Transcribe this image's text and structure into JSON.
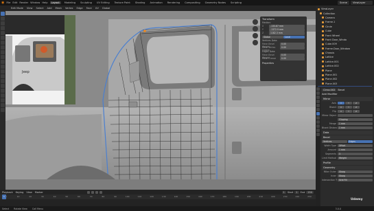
{
  "topbar": {
    "menus": [
      "File",
      "Edit",
      "Render",
      "Window",
      "Help"
    ],
    "tabs": [
      "Layout",
      "Modeling",
      "Sculpting",
      "UV Editing",
      "Texture Paint",
      "Shading",
      "Animation",
      "Rendering",
      "Compositing",
      "Geometry Nodes",
      "Scripting"
    ],
    "active_tab": "Layout",
    "scene": "Scene",
    "view_layer": "ViewLayer"
  },
  "viewport_header": {
    "mode": "Edit Mode",
    "menus": [
      "View",
      "Select",
      "Add",
      "Mesh",
      "Vertex",
      "Edge",
      "Face",
      "UV"
    ],
    "orientation": "Global"
  },
  "npanel": {
    "title": "Transform",
    "median": "Median:",
    "x": "-133.87 mm",
    "y": "-1372.9 mm",
    "z": "1182.3 mm",
    "space_global": "Global",
    "space_local": "Local",
    "vertex_data": "Vertices Data:",
    "mean_bevel_weight_label": "Mean Bevel Weight",
    "mean_bevel_weight": "0.00",
    "mean_vertex_crease_label": "Mean Vertex Crease",
    "mean_vertex_crease": "0.00",
    "edges_data": "Edges Data:",
    "mean_bevel_weight2": "0.00",
    "mean_crease_label": "Mean Crease",
    "mean_crease": "0.00",
    "properties": "Properties"
  },
  "outliner": {
    "items": [
      "ViewLayer",
      "Collection",
      "Camera",
      "Frame.1",
      "Circle",
      "Cube",
      "Front Wheel",
      "Front Door_Windo",
      "Cube.009",
      "Frame.Door_Window",
      "Chassis",
      "Lattice",
      "Lattice.001",
      "Lattice.002",
      "Plane",
      "Plane.001",
      "Plane.002",
      "Plane.003",
      "Plane.004"
    ],
    "selected": "Plane.004"
  },
  "properties": {
    "object": "Cirna.002",
    "modifier_tab": "Bevel",
    "add_modifier": "Add Modifier",
    "mirror_name": "Mirror",
    "axis_label": "Axis",
    "bisect_label": "Bisect",
    "flip_label": "Flip",
    "x": "X",
    "y": "Y",
    "z": "Z",
    "mirror_object_label": "Mirror Object",
    "clipping": "Clipping",
    "merge_label": "Merge",
    "merge_value": "1 mm",
    "bisect_distance_label": "Bisect Distance",
    "bisect_distance": "1 mm",
    "data_section": "Data",
    "bevel_name": "Bevel",
    "vertices": "Vertices",
    "edges": "Edges",
    "width_type_label": "Width Type",
    "width_type": "Offset",
    "amount_label": "Amount",
    "amount": "1 mm",
    "segments_label": "Segments",
    "segments": "3",
    "limit_method_label": "Limit Method",
    "limit_method": "Weight",
    "profile": "Profile",
    "geometry": "Geometry",
    "miter_outer_label": "Miter Outer",
    "miter_outer": "Sharp",
    "inner_label": "Inner",
    "inner": "Sharp",
    "intersection_label": "Intersection Type",
    "intersection": "Grid Fill"
  },
  "timeline": {
    "menus": [
      "Playback",
      "Keying",
      "View",
      "Marker"
    ],
    "current_frame": "1",
    "start_label": "Start",
    "start": "1",
    "end_label": "End",
    "end": "250",
    "ticks": [
      "0",
      "10",
      "20",
      "30",
      "40",
      "50",
      "60",
      "70",
      "80",
      "90",
      "100",
      "110",
      "120",
      "130",
      "140",
      "150",
      "160",
      "170",
      "180",
      "190",
      "200",
      "210",
      "220",
      "230",
      "240",
      "250"
    ]
  },
  "statusbar": {
    "select": "Select",
    "rotate": "Rotate View",
    "call_menu": "Call Menu",
    "version": "3.0.0"
  },
  "watermark": "Udemy",
  "colors": {
    "accent": "#4772b3",
    "orange": "#e87d0d",
    "selection_blue": "#334d80"
  }
}
